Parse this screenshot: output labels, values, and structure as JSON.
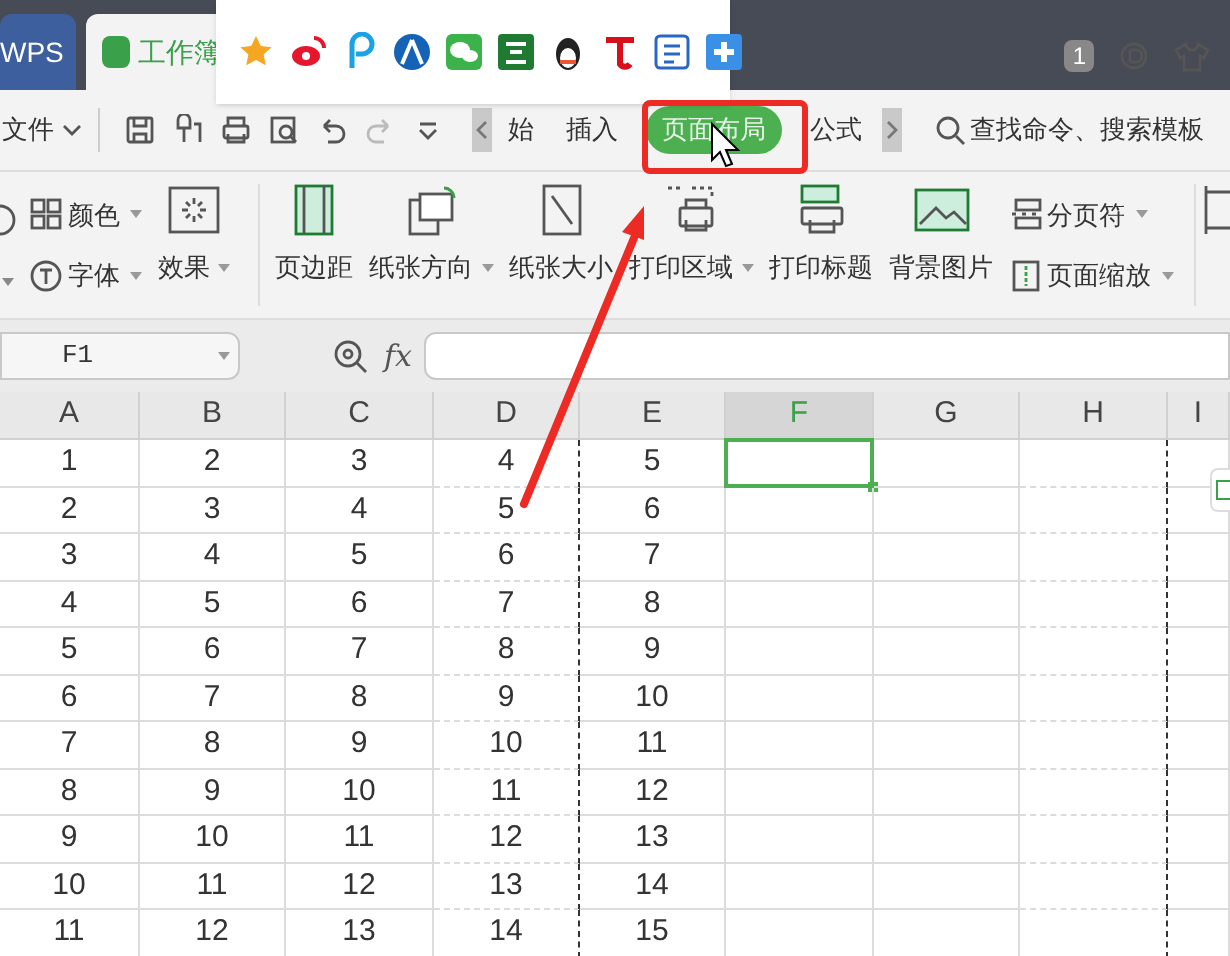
{
  "title_bar": {
    "tabs": [
      {
        "label": "WPS",
        "selected": false
      },
      {
        "label": "工作簿",
        "selected": true
      }
    ],
    "window_count": "1"
  },
  "menu_bar": {
    "file_menu": "文件",
    "tabs": [
      {
        "label": "始",
        "selected": false
      },
      {
        "label": "插入",
        "selected": false
      },
      {
        "label": "页面布局",
        "selected": true
      },
      {
        "label": "公式",
        "selected": false
      }
    ],
    "search": "查找命令、搜索模板"
  },
  "ribbon": {
    "small_left": [
      {
        "label": "颜色"
      },
      {
        "label": "字体"
      }
    ],
    "large": [
      {
        "label": "效果",
        "dropdown": true
      },
      {
        "label": "页边距",
        "dropdown": false
      },
      {
        "label": "纸张方向",
        "dropdown": true
      },
      {
        "label": "纸张大小",
        "dropdown": false
      },
      {
        "label": "打印区域",
        "dropdown": true
      },
      {
        "label": "打印标题",
        "dropdown": false
      },
      {
        "label": "背景图片",
        "dropdown": false
      }
    ],
    "small_right": [
      {
        "label": "分页符"
      },
      {
        "label": "页面缩放"
      }
    ]
  },
  "formula_bar": {
    "name_box": "F1",
    "fx": "fx"
  },
  "sheet": {
    "columns": [
      {
        "label": "A",
        "selected": false
      },
      {
        "label": "B",
        "selected": false
      },
      {
        "label": "C",
        "selected": false
      },
      {
        "label": "D",
        "selected": false
      },
      {
        "label": "E",
        "selected": false
      },
      {
        "label": "F",
        "selected": true
      },
      {
        "label": "G",
        "selected": false
      },
      {
        "label": "H",
        "selected": false
      },
      {
        "label": "I",
        "selected": false
      }
    ],
    "rows": [
      [
        "1",
        "2",
        "3",
        "4",
        "5"
      ],
      [
        "2",
        "3",
        "4",
        "5",
        "6"
      ],
      [
        "3",
        "4",
        "5",
        "6",
        "7"
      ],
      [
        "4",
        "5",
        "6",
        "7",
        "8"
      ],
      [
        "5",
        "6",
        "7",
        "8",
        "9"
      ],
      [
        "6",
        "7",
        "8",
        "9",
        "10"
      ],
      [
        "7",
        "8",
        "9",
        "10",
        "11"
      ],
      [
        "8",
        "9",
        "10",
        "11",
        "12"
      ],
      [
        "9",
        "10",
        "11",
        "12",
        "13"
      ],
      [
        "10",
        "11",
        "12",
        "13",
        "14"
      ],
      [
        "11",
        "12",
        "13",
        "14",
        "15"
      ]
    ]
  }
}
